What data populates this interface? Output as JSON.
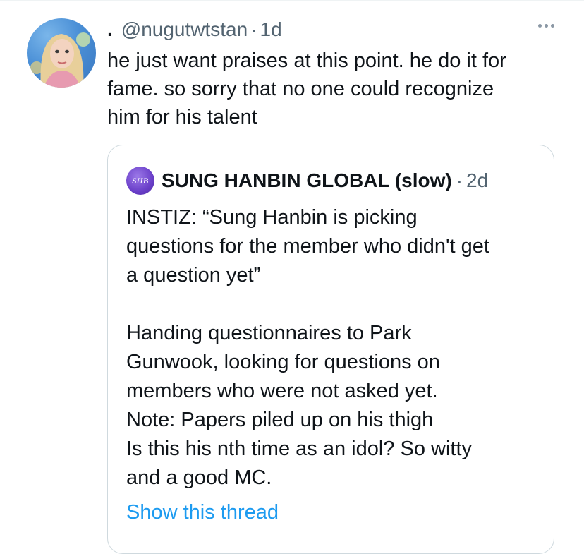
{
  "tweet": {
    "display_name": ".",
    "handle": "@nugutwtstan",
    "separator": "·",
    "time": "1d",
    "text": "he just want praises at this point. he do it for\nfame. so sorry that no one could recognize\nhim for his talent",
    "avatar_icon": "profile-photo-icon"
  },
  "quoted_tweet": {
    "avatar_text": "SHB",
    "display_name": "SUNG HANBIN GLOBAL (slow)",
    "separator": "·",
    "time": "2d",
    "text": "INSTIZ: “Sung Hanbin is picking\nquestions for the member who didn't get\na question yet”\n\nHanding questionnaires to Park\nGunwook, looking for questions on\nmembers who were not asked yet.\nNote: Papers piled up on his thigh\nIs this his nth time as an idol? So witty\nand a good MC.",
    "show_thread_label": "Show this thread"
  },
  "colors": {
    "text_primary": "#0f1419",
    "text_secondary": "#536471",
    "link": "#1d9bf0",
    "border": "#cfd9de"
  }
}
